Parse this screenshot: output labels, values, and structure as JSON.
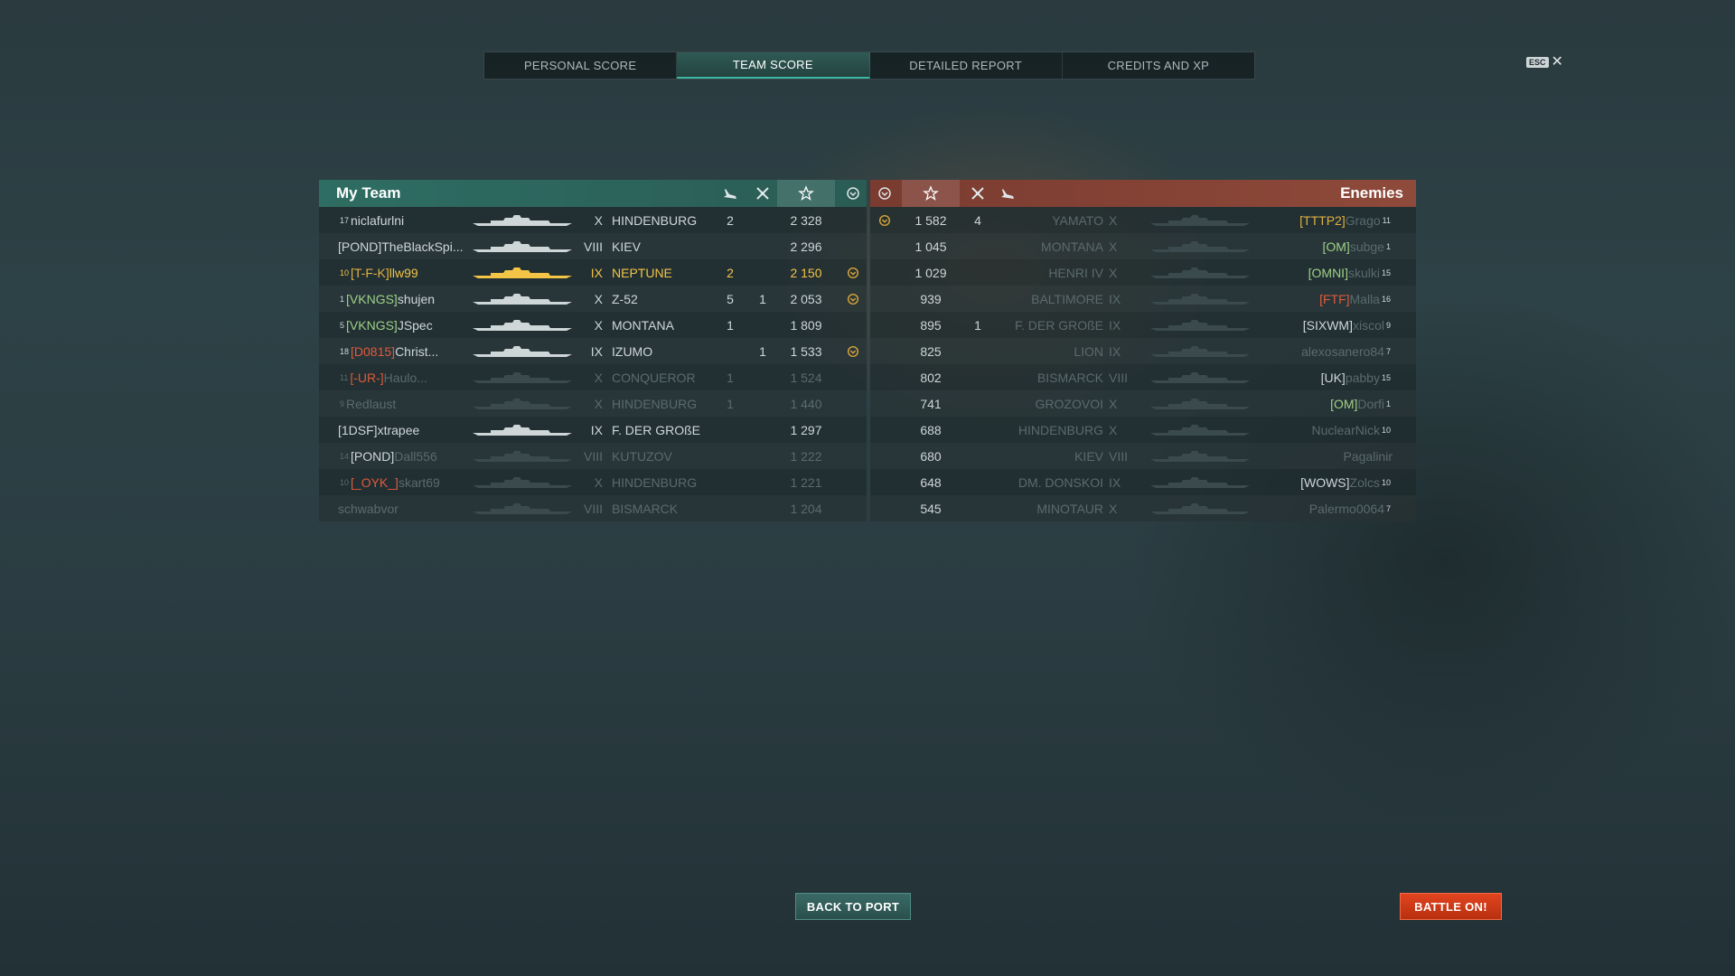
{
  "tabs": [
    {
      "label": "PERSONAL SCORE",
      "active": false
    },
    {
      "label": "TEAM SCORE",
      "active": true
    },
    {
      "label": "DETAILED REPORT",
      "active": false
    },
    {
      "label": "CREDITS AND XP",
      "active": false
    }
  ],
  "esc": {
    "key": "ESC",
    "close": "✕"
  },
  "my_team": {
    "title": "My Team",
    "rows": [
      {
        "service": "17",
        "clan": "",
        "name": "niclafurlni",
        "tier": "X",
        "ship": "HINDENBURG",
        "planes": "2",
        "ships": "",
        "score": "2 328",
        "achv": false,
        "state": "alive"
      },
      {
        "service": "",
        "clan": "[POND]",
        "name": "TheBlackSpi...",
        "tier": "VIII",
        "ship": "KIEV",
        "planes": "",
        "ships": "",
        "score": "2 296",
        "achv": false,
        "state": "alive"
      },
      {
        "service": "10",
        "clan": "[T-F-K]",
        "name": "llw99",
        "tier": "IX",
        "ship": "NEPTUNE",
        "planes": "2",
        "ships": "",
        "score": "2 150",
        "achv": true,
        "state": "me"
      },
      {
        "service": "1",
        "clan": "[VKNGS]",
        "name": "shujen",
        "tier": "X",
        "ship": "Z-52",
        "planes": "5",
        "ships": "1",
        "score": "2 053",
        "achv": true,
        "state": "alive"
      },
      {
        "service": "5",
        "clan": "[VKNGS]",
        "name": "JSpec",
        "tier": "X",
        "ship": "MONTANA",
        "planes": "1",
        "ships": "",
        "score": "1 809",
        "achv": false,
        "state": "alive"
      },
      {
        "service": "18",
        "clan": "[D0815]",
        "name": "Christ...",
        "tier": "IX",
        "ship": "IZUMO",
        "planes": "",
        "ships": "1",
        "score": "1 533",
        "achv": true,
        "state": "alive"
      },
      {
        "service": "11",
        "clan": "[-UR-]",
        "name": "Haulo...",
        "tier": "X",
        "ship": "CONQUEROR",
        "planes": "1",
        "ships": "",
        "score": "1 524",
        "achv": false,
        "state": "dead"
      },
      {
        "service": "9",
        "clan": "",
        "name": "Redlaust",
        "tier": "X",
        "ship": "HINDENBURG",
        "planes": "1",
        "ships": "",
        "score": "1 440",
        "achv": false,
        "state": "dead"
      },
      {
        "service": "",
        "clan": "[1DSF]",
        "name": "xtrapee",
        "tier": "IX",
        "ship": "F. DER GROßE",
        "planes": "",
        "ships": "",
        "score": "1 297",
        "achv": false,
        "state": "alive"
      },
      {
        "service": "14",
        "clan": "[POND]",
        "name": "Dall556",
        "tier": "VIII",
        "ship": "KUTUZOV",
        "planes": "",
        "ships": "",
        "score": "1 222",
        "achv": false,
        "state": "dead"
      },
      {
        "service": "10",
        "clan": "[_OYK_]",
        "name": "skart69",
        "tier": "X",
        "ship": "HINDENBURG",
        "planes": "",
        "ships": "",
        "score": "1 221",
        "achv": false,
        "state": "dead"
      },
      {
        "service": "",
        "clan": "",
        "name": "schwabvor",
        "tier": "VIII",
        "ship": "BISMARCK",
        "planes": "",
        "ships": "",
        "score": "1 204",
        "achv": false,
        "state": "dead"
      }
    ]
  },
  "enemies": {
    "title": "Enemies",
    "rows": [
      {
        "achv": true,
        "score": "1 582",
        "ships": "4",
        "planes": "",
        "ship": "YAMATO",
        "tier": "X",
        "clan": "[TTTP2]",
        "name": "Grago",
        "service": "11",
        "state": "dead"
      },
      {
        "achv": false,
        "score": "1 045",
        "ships": "",
        "planes": "",
        "ship": "MONTANA",
        "tier": "X",
        "clan": "[OM]",
        "name": "subge",
        "service": "1",
        "state": "dead"
      },
      {
        "achv": false,
        "score": "1 029",
        "ships": "",
        "planes": "",
        "ship": "HENRI IV",
        "tier": "X",
        "clan": "[OMNI]",
        "name": "skulki",
        "service": "15",
        "state": "dead"
      },
      {
        "achv": false,
        "score": "939",
        "ships": "",
        "planes": "",
        "ship": "BALTIMORE",
        "tier": "IX",
        "clan": "[FTF]",
        "name": "Malla",
        "service": "16",
        "state": "dead"
      },
      {
        "achv": false,
        "score": "895",
        "ships": "1",
        "planes": "",
        "ship": "F. DER GROßE",
        "tier": "IX",
        "clan": "[SIXWM]",
        "name": "xiscol",
        "service": "9",
        "state": "dead"
      },
      {
        "achv": false,
        "score": "825",
        "ships": "",
        "planes": "",
        "ship": "LION",
        "tier": "IX",
        "clan": "",
        "name": "alexosanero84",
        "service": "7",
        "state": "dead"
      },
      {
        "achv": false,
        "score": "802",
        "ships": "",
        "planes": "",
        "ship": "BISMARCK",
        "tier": "VIII",
        "clan": "[UK]",
        "name": "pabby",
        "service": "15",
        "state": "dead"
      },
      {
        "achv": false,
        "score": "741",
        "ships": "",
        "planes": "",
        "ship": "GROZOVOI",
        "tier": "X",
        "clan": "[OM]",
        "name": "Dorfi",
        "service": "1",
        "state": "dead"
      },
      {
        "achv": false,
        "score": "688",
        "ships": "",
        "planes": "",
        "ship": "HINDENBURG",
        "tier": "X",
        "clan": "",
        "name": "NuclearNick",
        "service": "10",
        "state": "dead"
      },
      {
        "achv": false,
        "score": "680",
        "ships": "",
        "planes": "",
        "ship": "KIEV",
        "tier": "VIII",
        "clan": "",
        "name": "Pagalinir",
        "service": "",
        "state": "dead"
      },
      {
        "achv": false,
        "score": "648",
        "ships": "",
        "planes": "",
        "ship": "DM. DONSKOI",
        "tier": "IX",
        "clan": "[WOWS]",
        "name": "Zolcs",
        "service": "10",
        "state": "dead"
      },
      {
        "achv": false,
        "score": "545",
        "ships": "",
        "planes": "",
        "ship": "MINOTAUR",
        "tier": "X",
        "clan": "",
        "name": "Palermo0064",
        "service": "7",
        "state": "dead"
      }
    ]
  },
  "buttons": {
    "back": "BACK TO PORT",
    "battle": "BATTLE ON!"
  },
  "colors": {
    "ally": "#2e6d63",
    "enemy": "#8e4a3a",
    "me": "#f3c445",
    "battle": "#d93a16"
  }
}
